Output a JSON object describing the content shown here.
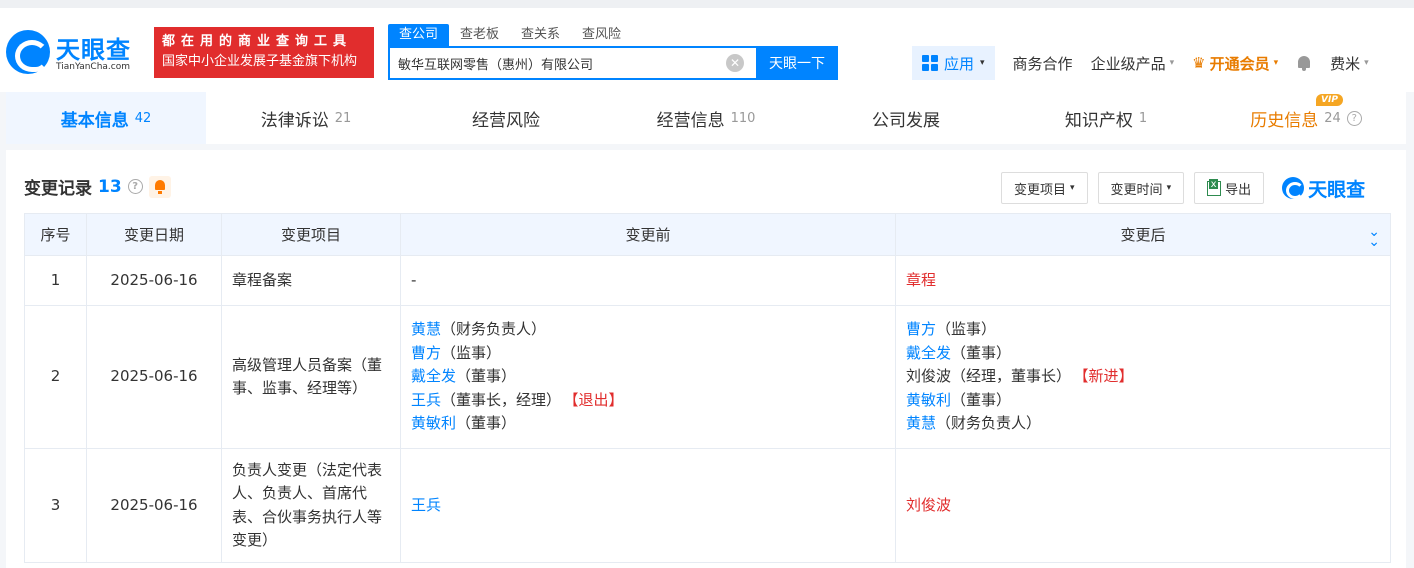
{
  "header": {
    "logo_name": "天眼查",
    "logo_domain": "TianYanCha.com",
    "slogan_line1": "都在用的商业查询工具",
    "slogan_line2": "国家中小企业发展子基金旗下机构",
    "search_tabs": [
      "查公司",
      "查老板",
      "查关系",
      "查风险"
    ],
    "search_value": "敏华互联网零售（惠州）有限公司",
    "clear_icon": "✕",
    "search_button": "天眼一下",
    "nav": {
      "apps": "应用",
      "business": "商务合作",
      "enterprise": "企业级产品",
      "vip": "开通会员",
      "user": "费米"
    },
    "caret": "▾",
    "vip_crown": "♛"
  },
  "tabs": [
    {
      "label": "基本信息",
      "count": "42"
    },
    {
      "label": "法律诉讼",
      "count": "21"
    },
    {
      "label": "经营风险",
      "count": ""
    },
    {
      "label": "经营信息",
      "count": "110"
    },
    {
      "label": "公司发展",
      "count": ""
    },
    {
      "label": "知识产权",
      "count": "1"
    },
    {
      "label": "历史信息",
      "count": "24",
      "badge": "VIP"
    }
  ],
  "section": {
    "title": "变更记录",
    "count": "13",
    "help": "?",
    "tools": {
      "filter_item": "变更项目",
      "filter_time": "变更时间",
      "export": "导出",
      "brand": "天眼查"
    }
  },
  "table": {
    "headers": [
      "序号",
      "变更日期",
      "变更项目",
      "变更前",
      "变更后"
    ],
    "expand_icon": "⌄",
    "rows": [
      {
        "no": "1",
        "date": "2025-06-16",
        "item": "章程备案",
        "before": [
          {
            "t": "-"
          }
        ],
        "after": [
          {
            "name": "章程",
            "name_color": "red"
          }
        ]
      },
      {
        "no": "2",
        "date": "2025-06-16",
        "item": "高级管理人员备案（董事、监事、经理等）",
        "before": [
          {
            "name": "黄慧",
            "role": "（财务负责人）"
          },
          {
            "name": "曹方",
            "role": "（监事）"
          },
          {
            "name": "戴全发",
            "role": "（董事）"
          },
          {
            "name": "王兵",
            "role": "（董事长，经理）",
            "tag": "【退出】"
          },
          {
            "name": "黄敏利",
            "role": "（董事）"
          }
        ],
        "after": [
          {
            "name": "曹方",
            "role": "（监事）"
          },
          {
            "name": "戴全发",
            "role": "（董事）"
          },
          {
            "name": "刘俊波",
            "role": "（经理，董事长）",
            "tag": "【新进】",
            "name_color": "plain"
          },
          {
            "name": "黄敏利",
            "role": "（董事）"
          },
          {
            "name": "黄慧",
            "role": "（财务负责人）"
          }
        ]
      },
      {
        "no": "3",
        "date": "2025-06-16",
        "item": "负责人变更（法定代表人、负责人、首席代表、合伙事务执行人等变更）",
        "before": [
          {
            "name": "王兵"
          }
        ],
        "after": [
          {
            "name": "刘俊波",
            "name_color": "red"
          }
        ]
      }
    ]
  },
  "colors": {
    "brand": "#0084ff",
    "red": "#e12d2d",
    "vip": "#e87c00"
  }
}
